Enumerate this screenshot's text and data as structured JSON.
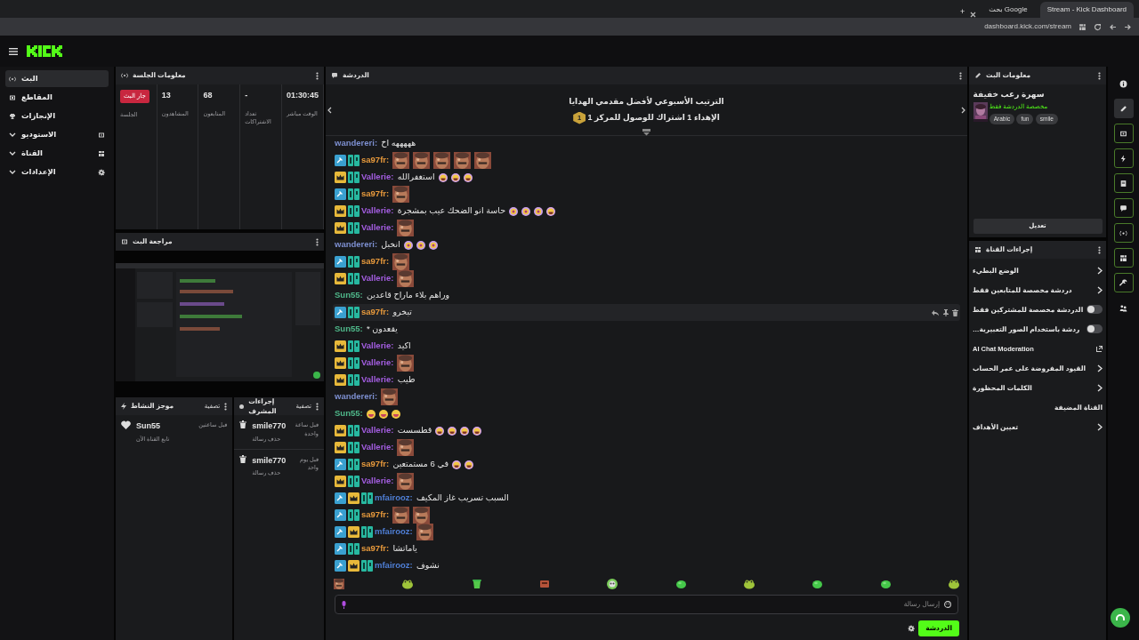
{
  "browser": {
    "tabs": [
      {
        "title": "Stream - Kick Dashboard",
        "selected": true
      },
      {
        "title": "بحث Google",
        "selected": false
      }
    ],
    "new_tab": "+",
    "url": "dashboard.kick.com/stream"
  },
  "sidebar": {
    "items": [
      {
        "label": "البث",
        "selected": true,
        "expandable": false
      },
      {
        "label": "المقاطع",
        "selected": false,
        "expandable": false
      },
      {
        "label": "الإنجازات",
        "selected": false,
        "expandable": false
      },
      {
        "label": "الاستوديو",
        "selected": false,
        "expandable": true
      },
      {
        "label": "القناة",
        "selected": false,
        "expandable": true
      },
      {
        "label": "الإعدادات",
        "selected": false,
        "expandable": true
      }
    ]
  },
  "session": {
    "title": "معلومات الجلسة",
    "stats": [
      {
        "kind": "number",
        "value": "01:30:45",
        "label": "الوقت مباشر"
      },
      {
        "kind": "number",
        "value": "-",
        "label": "تعداد الاشتراكات"
      },
      {
        "kind": "number",
        "value": "68",
        "label": "المتابعون"
      },
      {
        "kind": "number",
        "value": "13",
        "label": "المشاهدون"
      },
      {
        "kind": "badge",
        "value": "جار البث",
        "label": "الجلسة"
      }
    ]
  },
  "preview": {
    "title": "مراجعة البث"
  },
  "activity": {
    "title": "موجز النشاط",
    "filter": "تصفية",
    "entries": [
      {
        "user": "Sun55",
        "action": "تابع القناة الآن",
        "time": "قبل ساعتين"
      }
    ]
  },
  "mod_actions": {
    "title": "إجراءات المشرف",
    "filter": "تصفية",
    "entries": [
      {
        "user": "smile770",
        "action": "حذف رسالة",
        "time": "قبل ساعة واحدة"
      },
      {
        "user": "smile770",
        "action": "حذف رسالة",
        "time": "قبل يوم واحد"
      }
    ]
  },
  "chat": {
    "title": "الدردشة",
    "leaderboard": {
      "title": "الترتيب الأسبوعي لأفضل مقدمي الهدايا",
      "rank": "1",
      "text": "الإهداء 1 اشتراك للوصول للمركز 1"
    },
    "messages": [
      {
        "user": "wandereri:",
        "color": "#7d8fd0",
        "text": "هههههه اخ",
        "hovered": false
      },
      {
        "user": "sa97fr:",
        "color": "#e89a3c",
        "badges": [
          {
            "kind": "mod"
          },
          {
            "kind": "og"
          }
        ],
        "emotes": [
          {
            "kind": "picture"
          },
          {
            "kind": "picture"
          },
          {
            "kind": "picture"
          },
          {
            "kind": "picture"
          },
          {
            "kind": "picture"
          }
        ],
        "hovered": false
      },
      {
        "user": "Vallerie:",
        "color": "#a35de0",
        "badges": [
          {
            "kind": "vip"
          },
          {
            "kind": "og"
          }
        ],
        "text": "استغفرالله",
        "emotes": [
          {
            "kind": "laugh"
          },
          {
            "kind": "laugh"
          },
          {
            "kind": "laugh"
          }
        ],
        "hovered": false
      },
      {
        "user": "sa97fr:",
        "color": "#e89a3c",
        "badges": [
          {
            "kind": "mod"
          },
          {
            "kind": "og"
          }
        ],
        "emotes": [
          {
            "kind": "picture"
          }
        ],
        "hovered": false
      },
      {
        "user": "Vallerie:",
        "color": "#a35de0",
        "badges": [
          {
            "kind": "vip"
          },
          {
            "kind": "og"
          }
        ],
        "text": "حاسة انو الضحك عيب بمشجرة",
        "emotes": [
          {
            "kind": "dizzy"
          },
          {
            "kind": "dizzy"
          },
          {
            "kind": "dizzy"
          },
          {
            "kind": "laugh"
          }
        ],
        "hovered": false
      },
      {
        "user": "Vallerie:",
        "color": "#a35de0",
        "badges": [
          {
            "kind": "vip"
          },
          {
            "kind": "og"
          }
        ],
        "emotes": [
          {
            "kind": "picture"
          }
        ],
        "hovered": false
      },
      {
        "user": "wandereri:",
        "color": "#7d8fd0",
        "text": "انخبل",
        "emotes": [
          {
            "kind": "dizzy"
          },
          {
            "kind": "dizzy"
          },
          {
            "kind": "dizzy"
          }
        ],
        "hovered": false
      },
      {
        "user": "sa97fr:",
        "color": "#e89a3c",
        "badges": [
          {
            "kind": "mod"
          },
          {
            "kind": "og"
          }
        ],
        "emotes": [
          {
            "kind": "picture"
          }
        ],
        "hovered": false
      },
      {
        "user": "Vallerie:",
        "color": "#a35de0",
        "badges": [
          {
            "kind": "vip"
          },
          {
            "kind": "og"
          }
        ],
        "emotes": [
          {
            "kind": "picture"
          }
        ],
        "hovered": false
      },
      {
        "user": "Sun55:",
        "color": "#4fb88a",
        "text": "وراهم بلاء ماراح قاعدين",
        "hovered": false
      },
      {
        "user": "sa97fr:",
        "color": "#e89a3c",
        "badges": [
          {
            "kind": "mod"
          },
          {
            "kind": "og"
          }
        ],
        "text": "تبخرو",
        "hovered": true
      },
      {
        "user": "Sun55:",
        "color": "#4fb88a",
        "text": "* يقعدون",
        "hovered": false
      },
      {
        "user": "Vallerie:",
        "color": "#a35de0",
        "badges": [
          {
            "kind": "vip"
          },
          {
            "kind": "og"
          }
        ],
        "text": "اكيد",
        "hovered": false
      },
      {
        "user": "Vallerie:",
        "color": "#a35de0",
        "badges": [
          {
            "kind": "vip"
          },
          {
            "kind": "og"
          }
        ],
        "emotes": [
          {
            "kind": "picture"
          }
        ],
        "hovered": false
      },
      {
        "user": "Vallerie:",
        "color": "#a35de0",
        "badges": [
          {
            "kind": "vip"
          },
          {
            "kind": "og"
          }
        ],
        "text": "طيب",
        "hovered": false
      },
      {
        "user": "wandereri:",
        "color": "#7d8fd0",
        "emotes": [
          {
            "kind": "picture"
          }
        ],
        "hovered": false
      },
      {
        "user": "Sun55:",
        "color": "#4fb88a",
        "emotes": [
          {
            "kind": "grin"
          },
          {
            "kind": "grin"
          },
          {
            "kind": "grin"
          }
        ],
        "hovered": false
      },
      {
        "user": "Vallerie:",
        "color": "#a35de0",
        "badges": [
          {
            "kind": "vip"
          },
          {
            "kind": "og"
          }
        ],
        "text": "قطسست",
        "emotes": [
          {
            "kind": "laugh"
          },
          {
            "kind": "laugh"
          },
          {
            "kind": "laugh"
          },
          {
            "kind": "laugh"
          }
        ],
        "hovered": false
      },
      {
        "user": "Vallerie:",
        "color": "#a35de0",
        "badges": [
          {
            "kind": "vip"
          },
          {
            "kind": "og"
          }
        ],
        "emotes": [
          {
            "kind": "picture"
          }
        ],
        "hovered": false
      },
      {
        "user": "sa97fr:",
        "color": "#e89a3c",
        "badges": [
          {
            "kind": "mod"
          },
          {
            "kind": "og"
          }
        ],
        "text": "في 6 مستمتعين",
        "emotes": [
          {
            "kind": "laugh"
          },
          {
            "kind": "laugh"
          }
        ],
        "hovered": false
      },
      {
        "user": "Vallerie:",
        "color": "#a35de0",
        "badges": [
          {
            "kind": "vip"
          },
          {
            "kind": "og"
          }
        ],
        "emotes": [
          {
            "kind": "picture"
          }
        ],
        "hovered": false
      },
      {
        "user": "mfairooz:",
        "color": "#4f7fd6",
        "badges": [
          {
            "kind": "mod"
          },
          {
            "kind": "vip"
          },
          {
            "kind": "og"
          }
        ],
        "text": "السبب تسريب غاز المكيف",
        "hovered": false
      },
      {
        "user": "sa97fr:",
        "color": "#e89a3c",
        "badges": [
          {
            "kind": "mod"
          },
          {
            "kind": "og"
          }
        ],
        "emotes": [
          {
            "kind": "picture"
          },
          {
            "kind": "picture"
          }
        ],
        "hovered": false
      },
      {
        "user": "mfairooz:",
        "color": "#4f7fd6",
        "badges": [
          {
            "kind": "mod"
          },
          {
            "kind": "vip"
          },
          {
            "kind": "og"
          }
        ],
        "emotes": [
          {
            "kind": "picture"
          }
        ],
        "hovered": false
      },
      {
        "user": "sa97fr:",
        "color": "#e89a3c",
        "badges": [
          {
            "kind": "mod"
          },
          {
            "kind": "og"
          }
        ],
        "text": "ياماتشا",
        "hovered": false
      },
      {
        "user": "mfairooz:",
        "color": "#4f7fd6",
        "badges": [
          {
            "kind": "mod"
          },
          {
            "kind": "vip"
          },
          {
            "kind": "og"
          }
        ],
        "text": "نشوف",
        "hovered": false
      }
    ],
    "emote_bar": [
      {
        "kind": "picture"
      },
      {
        "kind": "frog"
      },
      {
        "kind": "cup"
      },
      {
        "kind": "box"
      },
      {
        "kind": "skull"
      },
      {
        "kind": "blob"
      },
      {
        "kind": "frog"
      },
      {
        "kind": "blob"
      },
      {
        "kind": "blob"
      },
      {
        "kind": "frog"
      }
    ],
    "input": {
      "placeholder": "إرسال رسالة"
    },
    "send_button": "الدردشة"
  },
  "stream_info": {
    "title": "معلومات البث",
    "stream_title": "سهرة رعب خفيفة",
    "category": "مخصصة الدردشة فقط",
    "tags": [
      "smile",
      "fun",
      "Arabic"
    ],
    "edit_button": "تعديل"
  },
  "channel_actions": {
    "title": "إجراءات القناة",
    "items": [
      {
        "kind": "submenu",
        "label": "الوضع البطيء"
      },
      {
        "kind": "submenu",
        "label": "دردشة مخصصة للمتابعين فقط"
      },
      {
        "kind": "toggle",
        "label": "الدردشة مخصصة للمشتركين فقط",
        "on": false
      },
      {
        "kind": "toggle",
        "label": "…ردشة باستخدام الصور التعبيرية",
        "on": false
      },
      {
        "kind": "external",
        "label": "AI Chat Moderation"
      },
      {
        "kind": "submenu",
        "label": "القيود المفروضة على عمر الحساب"
      },
      {
        "kind": "submenu",
        "label": "الكلمات المحظورة"
      },
      {
        "kind": "heading",
        "label": "القناة المضيفة"
      },
      {
        "kind": "submenu",
        "label": "تعيين الأهداف"
      }
    ]
  },
  "rail": [
    {
      "kind": "plain",
      "selected": false
    },
    {
      "kind": "plain",
      "selected": true
    },
    {
      "kind": "boxed",
      "selected": false
    },
    {
      "kind": "boxed",
      "selected": false
    },
    {
      "kind": "boxed",
      "selected": false
    },
    {
      "kind": "boxed",
      "selected": false
    },
    {
      "kind": "boxed",
      "selected": false
    },
    {
      "kind": "boxed",
      "selected": false
    },
    {
      "kind": "boxed",
      "selected": false
    },
    {
      "kind": "plain",
      "selected": false
    }
  ]
}
